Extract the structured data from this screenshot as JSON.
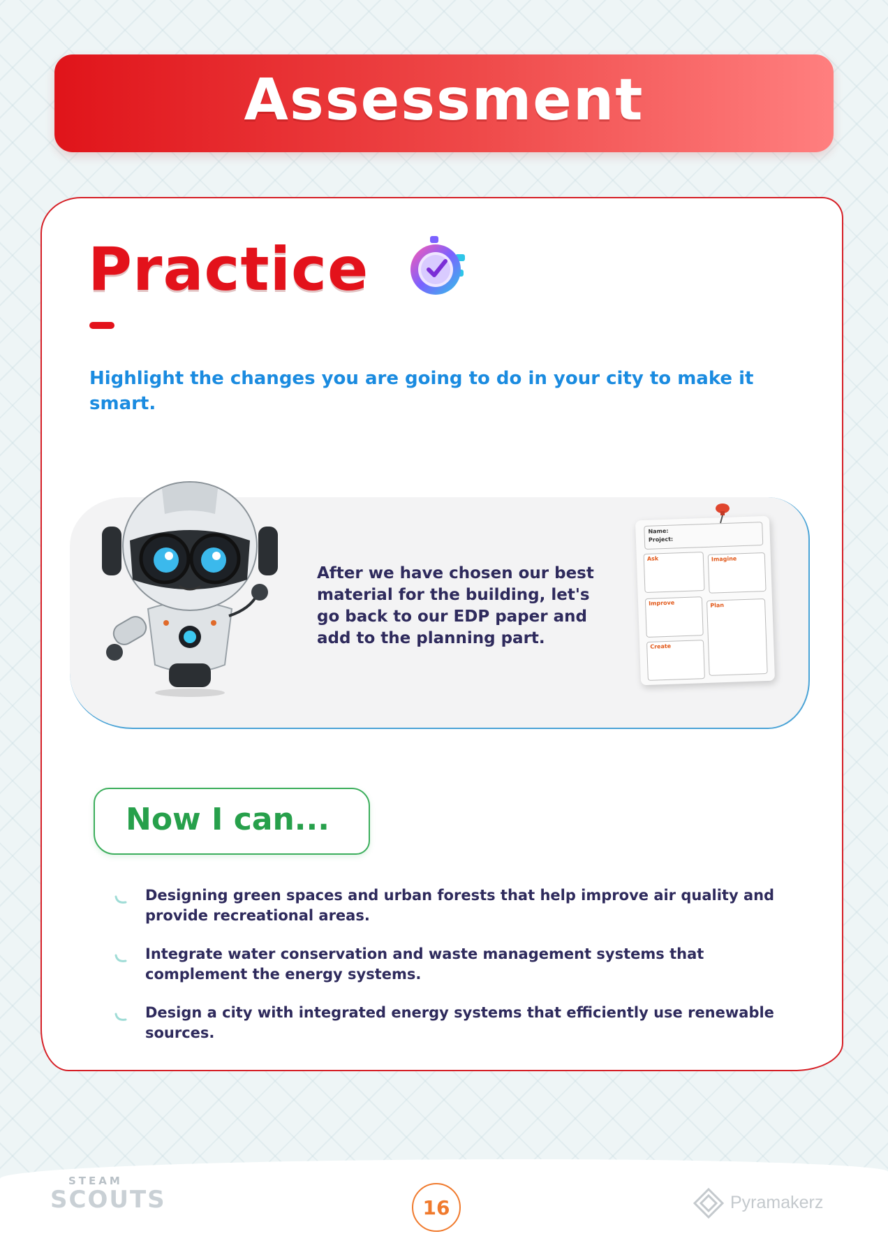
{
  "header": {
    "title": "Assessment"
  },
  "practice": {
    "title": "Practice",
    "instruction": "Highlight the changes you are going to do in your city to make it smart."
  },
  "info_box": {
    "text": "After we have chosen our best material for the building, let's go back to our EDP paper and add to the planning part.",
    "edp_sheet": {
      "name_label": "Name:",
      "project_label": "Project:",
      "cells": [
        "Ask",
        "Imagine",
        "Improve",
        "Plan",
        "Create"
      ]
    }
  },
  "now_i_can": {
    "label": "Now I can...",
    "items": [
      "Designing green spaces and urban forests that help improve air quality and provide recreational areas.",
      "Integrate water conservation and waste management systems that complement the energy systems.",
      "Design a city with integrated energy systems that efficiently use renewable sources."
    ]
  },
  "footer": {
    "left_logo_top": "STEAM",
    "left_logo_bottom": "SCOUTS",
    "page_number": "16",
    "right_logo": "Pyramakerz"
  },
  "colors": {
    "accent_red": "#e3121b",
    "instruction_blue": "#1a8be0",
    "body_navy": "#2e2a5c",
    "green": "#27a04b",
    "orange": "#f07a2d"
  }
}
